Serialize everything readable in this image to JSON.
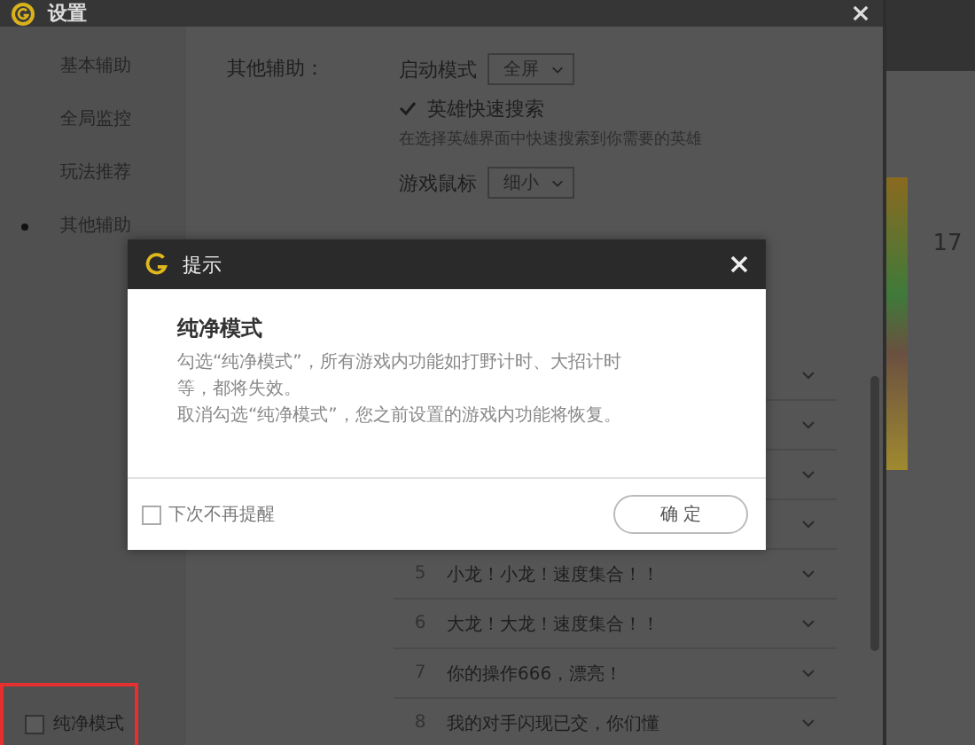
{
  "settings_window": {
    "title": "设置",
    "sidebar": {
      "items": [
        {
          "label": "基本辅助",
          "selected": false
        },
        {
          "label": "全局监控",
          "selected": false
        },
        {
          "label": "玩法推荐",
          "selected": false
        },
        {
          "label": "其他辅助",
          "selected": true
        }
      ]
    },
    "section_label": "其他辅助：",
    "launch_mode": {
      "label": "启动模式",
      "value": "全屏"
    },
    "hero_search": {
      "label": "英雄快速搜索",
      "checked": true,
      "hint": "在选择英雄界面中快速搜索到你需要的英雄"
    },
    "game_cursor": {
      "label": "游戏鼠标",
      "value": "细小"
    },
    "quick_messages": [
      {
        "number": "5",
        "text": "小龙！小龙！速度集合！！"
      },
      {
        "number": "6",
        "text": "大龙！大龙！速度集合！！"
      },
      {
        "number": "7",
        "text": "你的操作666，漂亮！"
      },
      {
        "number": "8",
        "text": "我的对手闪现已交，你们懂"
      }
    ],
    "pure_mode": {
      "label": "纯净模式",
      "checked": false
    }
  },
  "background_app": {
    "number": "17"
  },
  "dialog": {
    "title": "提示",
    "heading": "纯净模式",
    "paragraphs": [
      "勾选“纯净模式”，所有游戏内功能如打野计时、大招计时等，都将失效。",
      "取消勾选“纯净模式”，您之前设置的游戏内功能将恢复。"
    ],
    "dont_remind": {
      "label": "下次不再提醒",
      "checked": false
    },
    "confirm_button": "确 定"
  }
}
